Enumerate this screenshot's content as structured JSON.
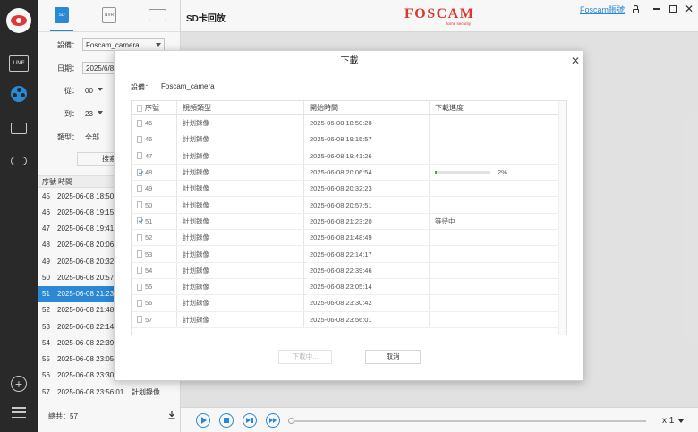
{
  "nav": {
    "live_label": "LIVE"
  },
  "panel": {
    "tabs": [
      {
        "label": "SD"
      },
      {
        "label": "NVR"
      },
      {
        "label": ""
      }
    ],
    "device_label": "設備：",
    "device_value": "Foscam_camera",
    "date_label": "日期：",
    "date_value": "2025/6/8",
    "from_label": "從：",
    "from_value": "00",
    "to_label": "到：",
    "to_value": "23",
    "type_label": "類型：",
    "type_value": "全部",
    "search_label": "搜索",
    "list_header_no": "序號",
    "list_header_time": "時間",
    "rows": [
      {
        "no": "45",
        "time": "2025-06-08 18:50:28",
        "type": ""
      },
      {
        "no": "46",
        "time": "2025-06-08 19:15:57",
        "type": ""
      },
      {
        "no": "47",
        "time": "2025-06-08 19:41:26",
        "type": ""
      },
      {
        "no": "48",
        "time": "2025-06-08 20:06:54",
        "type": ""
      },
      {
        "no": "49",
        "time": "2025-06-08 20:32:23",
        "type": ""
      },
      {
        "no": "50",
        "time": "2025-06-08 20:57:51",
        "type": ""
      },
      {
        "no": "51",
        "time": "2025-06-08 21:23:20",
        "type": ""
      },
      {
        "no": "52",
        "time": "2025-06-08 21:48:49",
        "type": ""
      },
      {
        "no": "53",
        "time": "2025-06-08 22:14:17",
        "type": ""
      },
      {
        "no": "54",
        "time": "2025-06-08 22:39:46",
        "type": ""
      },
      {
        "no": "55",
        "time": "2025-06-08 23:05:14",
        "type": ""
      },
      {
        "no": "56",
        "time": "2025-06-08 23:30:42",
        "type": ""
      },
      {
        "no": "57",
        "time": "2025-06-08 23:56:01",
        "type": "計划錄像"
      }
    ],
    "total_label": "總共：57"
  },
  "topbar": {
    "title": "SD卡回放",
    "brand": "FOSCAM",
    "brand_sub": "home security",
    "account": "Foscam賬號"
  },
  "playbar": {
    "speed": "x 1"
  },
  "dialog": {
    "title": "下載",
    "device_label": "設備：",
    "device_value": "Foscam_camera",
    "columns": [
      "序號",
      "視頻類型",
      "開始時間",
      "下載進度"
    ],
    "rows": [
      {
        "no": "45",
        "type": "計划錄像",
        "start": "2025-06-08 18:50:28",
        "checked": false,
        "status": "",
        "progress": null
      },
      {
        "no": "46",
        "type": "計划錄像",
        "start": "2025-06-08 19:15:57",
        "checked": false,
        "status": "",
        "progress": null
      },
      {
        "no": "47",
        "type": "計划錄像",
        "start": "2025-06-08 19:41:26",
        "checked": false,
        "status": "",
        "progress": null
      },
      {
        "no": "48",
        "type": "計划錄像",
        "start": "2025-06-08 20:06:54",
        "checked": true,
        "status": "2%",
        "progress": 0.02
      },
      {
        "no": "49",
        "type": "計划錄像",
        "start": "2025-06-08 20:32:23",
        "checked": false,
        "status": "",
        "progress": null
      },
      {
        "no": "50",
        "type": "計划錄像",
        "start": "2025-06-08 20:57:51",
        "checked": false,
        "status": "",
        "progress": null
      },
      {
        "no": "51",
        "type": "計划錄像",
        "start": "2025-06-08 21:23:20",
        "checked": true,
        "status": "等待中",
        "progress": null
      },
      {
        "no": "52",
        "type": "計划錄像",
        "start": "2025-06-08 21:48:49",
        "checked": false,
        "status": "",
        "progress": null
      },
      {
        "no": "53",
        "type": "計划錄像",
        "start": "2025-06-08 22:14:17",
        "checked": false,
        "status": "",
        "progress": null
      },
      {
        "no": "54",
        "type": "計划錄像",
        "start": "2025-06-08 22:39:46",
        "checked": false,
        "status": "",
        "progress": null
      },
      {
        "no": "55",
        "type": "計划錄像",
        "start": "2025-06-08 23:05:14",
        "checked": false,
        "status": "",
        "progress": null
      },
      {
        "no": "56",
        "type": "計划錄像",
        "start": "2025-06-08 23:30:42",
        "checked": false,
        "status": "",
        "progress": null
      },
      {
        "no": "57",
        "type": "計划錄像",
        "start": "2025-06-08 23:56:01",
        "checked": false,
        "status": "",
        "progress": null
      }
    ],
    "downloading_label": "下載中...",
    "cancel_label": "取消"
  },
  "colors": {
    "accent": "#2c8ddc",
    "brand": "#e13a2e",
    "progress": "#2fb34a",
    "rail": "#2b2b2b"
  },
  "icons": [
    "logo-icon",
    "live-icon",
    "playback-icon",
    "message-icon",
    "cloud-icon",
    "add-icon",
    "menu-icon",
    "lock-icon",
    "minimize-icon",
    "maximize-icon",
    "close-icon",
    "download-icon",
    "play-icon",
    "stop-icon",
    "next-icon",
    "fast-forward-icon"
  ]
}
